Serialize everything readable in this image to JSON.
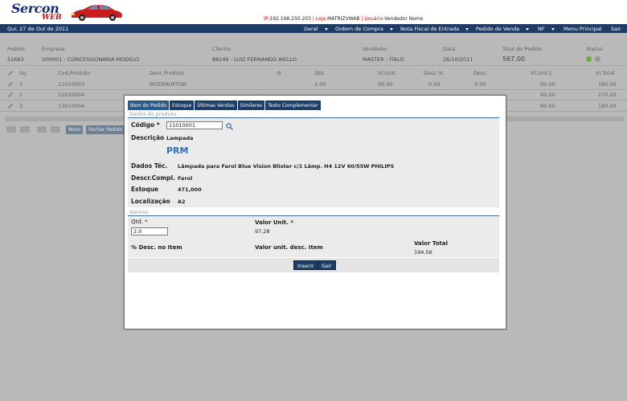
{
  "header": {
    "logo_line1": "Sercon",
    "logo_line2": "WEB",
    "ip_label": "IP:",
    "ip_value": "192.168.250.203",
    "sep1": " | ",
    "loja_label": "Loja:",
    "loja_value": "MATRIZVWAB",
    "sep2": " | ",
    "usuario_label": "Usuário:",
    "usuario_value": "Vendedor Nome"
  },
  "menubar": {
    "date": "Qui, 27 de Out de 2011",
    "items": [
      "Geral",
      "Ordem de Compra",
      "Nota Fiscal de Entrada",
      "Pedido de Venda",
      "NF",
      "Menu Principal",
      "Sair"
    ]
  },
  "order": {
    "headers": [
      "Pedido",
      "Empresa",
      "Cliente",
      "Vendedor",
      "Data",
      "Total do Pedido",
      "Status"
    ],
    "values": [
      "51663",
      "U00001 - CONCESSIONARIA MODELO",
      "88249 - LUIZ FERNANDO AIELLO",
      "MASTER - ITALO",
      "26/10/2011",
      "567.00"
    ]
  },
  "items_table": {
    "headers": [
      "Sq",
      "Cod.Produto",
      "Desc.Produto",
      "Qtd.",
      "Vl.Unit.",
      "Desc.%",
      "Desc.",
      "Vl.Unit.L",
      "Vl.Total"
    ],
    "rows": [
      {
        "sq": "1",
        "cod": "11010003",
        "desc": "INTERRUPTOR",
        "qtd": "2.00",
        "vlunit": "90.00",
        "descp": "0.00",
        "desc_v": "0.00",
        "vlunitl": "90.00",
        "total": "180.00"
      },
      {
        "sq": "2",
        "cod": "12030004",
        "desc": "",
        "qtd": "",
        "vlunit": "",
        "descp": "",
        "desc_v": "",
        "vlunitl": "90.00",
        "total": "270.00"
      },
      {
        "sq": "3",
        "cod": "13010004",
        "desc": "",
        "qtd": "",
        "vlunit": "",
        "descp": "",
        "desc_v": "",
        "vlunitl": "90.00",
        "total": "180.00"
      }
    ],
    "buttons": [
      "Novo",
      "Fechar Pedido"
    ]
  },
  "modal": {
    "tabs": [
      "Item do Pedido",
      "Estoque",
      "Últimas Vendas",
      "Similares",
      "Texto Complementar"
    ],
    "section_product": "Dados do produto",
    "codigo_label": "Código *",
    "codigo_value": "11010001",
    "descricao_label": "Descrição",
    "descricao_value": "Lampada",
    "brand": "PRM",
    "dados_tec_label": "Dados Téc.",
    "dados_tec_value": "Lâmpada para Farol Blue Vision Blister c/1 Lâmp. H4 12V 60/55W PHILIPS",
    "descr_compl_label": "Descr.Compl.",
    "descr_compl_value": "Farol",
    "estoque_label": "Estoque",
    "estoque_value": "471,000",
    "localizacao_label": "Localização",
    "localizacao_value": "A2",
    "section_valores": "Valores",
    "qtd_label": "Qtd. *",
    "qtd_value": "2.0",
    "valor_unit_label": "Valor Unit. *",
    "valor_unit_value": "97,28",
    "desc_item_label": "% Desc. no Item",
    "valor_unit_desc_label": "Valor unit. desc. Item",
    "valor_total_label": "Valor Total",
    "valor_total_value": "194,56",
    "inserir_label": "Inserir",
    "sair_label": "Sair"
  },
  "colors": {
    "navy": "#1d3d66",
    "brand_red": "#c0121b",
    "link_blue": "#2b6cb5",
    "status_green": "#6fae3a"
  }
}
